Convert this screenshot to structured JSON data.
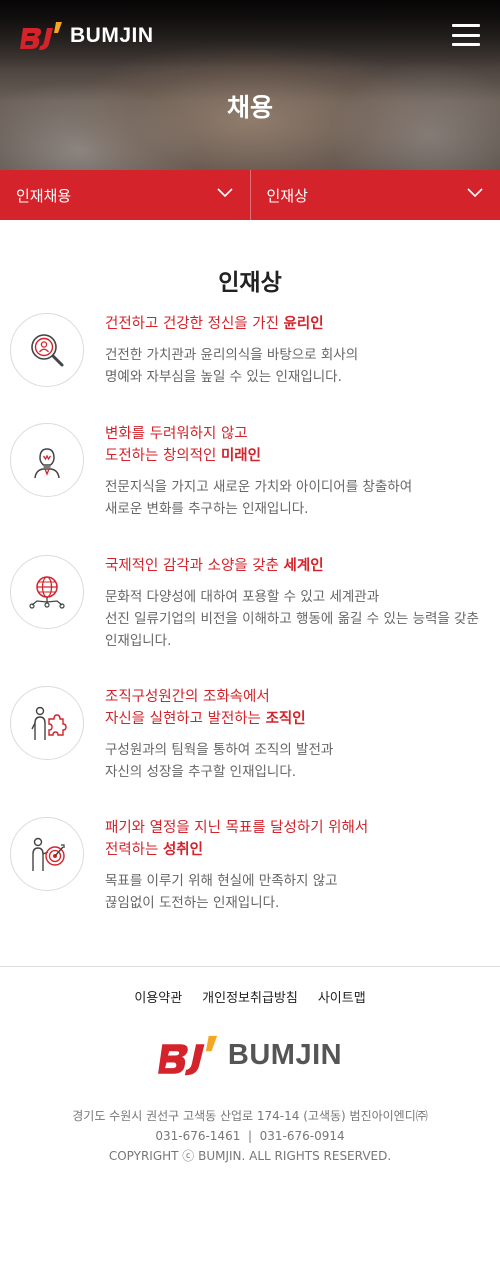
{
  "header": {
    "logo_mark": "BJ",
    "brand": "BUMJIN",
    "title": "채용",
    "colors": {
      "accent": "#d4232b",
      "logo_orange": "#f5a623"
    }
  },
  "subnav": {
    "left": {
      "label": "인재채용"
    },
    "right": {
      "label": "인재상"
    }
  },
  "section": {
    "title": "인재상"
  },
  "items": [
    {
      "icon": "magnifier-person-icon",
      "head_normal": "건전하고 건강한 정신을 가진 ",
      "head_bold": "윤리인",
      "head_line2_normal": "",
      "head_line2_bold": "",
      "desc1": "건전한 가치관과 윤리의식을 바탕으로 회사의",
      "desc2": "명예와 자부심을 높일 수 있는 인재입니다.",
      "desc3": ""
    },
    {
      "icon": "lightbulb-person-icon",
      "head_normal": "변화를 두려워하지 않고",
      "head_bold": "",
      "head_line2_normal": "도전하는 창의적인 ",
      "head_line2_bold": "미래인",
      "desc1": "전문지식을 가지고 새로운 가치와 아이디어를 창출하여",
      "desc2": "새로운 변화를 추구하는 인재입니다.",
      "desc3": ""
    },
    {
      "icon": "globe-network-icon",
      "head_normal": "국제적인 감각과 소양을 갖춘 ",
      "head_bold": "세계인",
      "head_line2_normal": "",
      "head_line2_bold": "",
      "desc1": "문화적 다양성에 대하여 포용할 수 있고 세계관과",
      "desc2": "선진 일류기업의 비전을 이해하고 행동에 옮길 수 있는 능력을 갖춘",
      "desc3": "인재입니다."
    },
    {
      "icon": "person-puzzle-icon",
      "head_normal": "조직구성원간의 조화속에서",
      "head_bold": "",
      "head_line2_normal": "자신을 실현하고 발전하는 ",
      "head_line2_bold": "조직인",
      "desc1": "구성원과의 팀웍을 통하여 조직의 발전과",
      "desc2": "자신의 성장을 추구할 인재입니다.",
      "desc3": ""
    },
    {
      "icon": "person-target-icon",
      "head_normal": "패기와 열정을 지닌 목표를 달성하기 위해서",
      "head_bold": "",
      "head_line2_normal": "전력하는 ",
      "head_line2_bold": "성취인",
      "desc1": "목표를 이루기 위해 현실에 만족하지 않고",
      "desc2": "끊임없이 도전하는 인재입니다.",
      "desc3": ""
    }
  ],
  "footer": {
    "links": [
      "이용약관",
      "개인정보취급방침",
      "사이트맵"
    ],
    "brand": "BUMJIN",
    "address": "경기도 수원시 권선구 고색동 산업로 174-14 (고색동) 범진아이엔디㈜",
    "phone": "031-676-1461  |  031-676-0914",
    "copyright": "COPYRIGHT ⓒ BUMJIN. ALL RIGHTS RESERVED."
  }
}
